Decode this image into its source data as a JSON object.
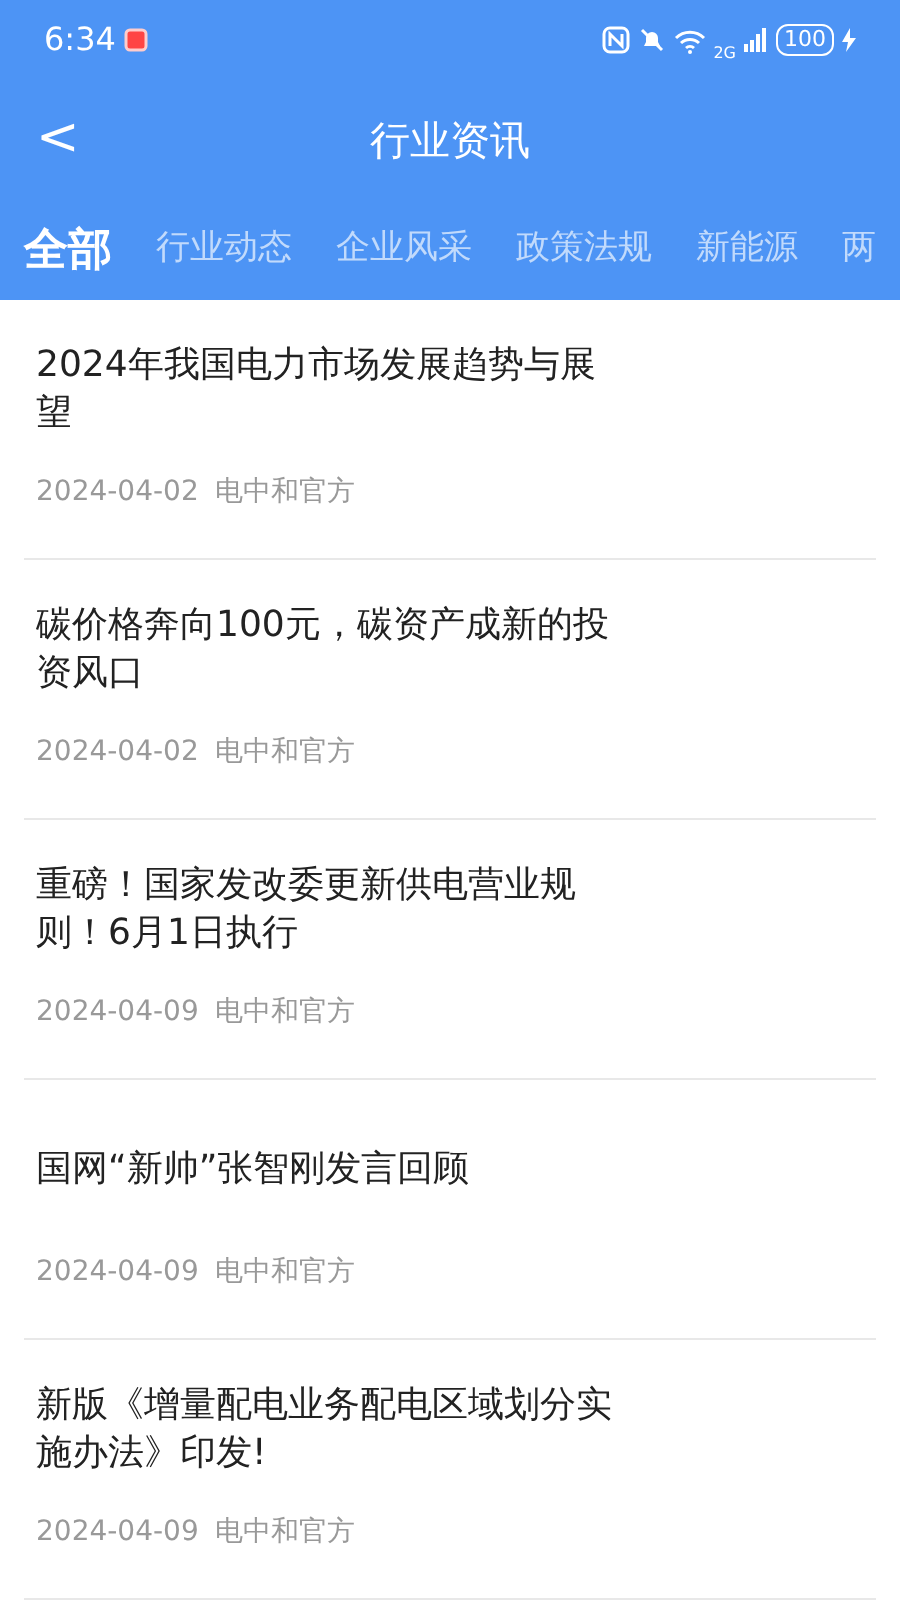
{
  "status_bar": {
    "time": "6:34",
    "network": "2G",
    "battery": "100"
  },
  "header": {
    "back": "<",
    "title": "行业资讯"
  },
  "tabs": [
    {
      "label": "全部",
      "selected": true
    },
    {
      "label": "行业动态",
      "selected": false
    },
    {
      "label": "企业风采",
      "selected": false
    },
    {
      "label": "政策法规",
      "selected": false
    },
    {
      "label": "新能源",
      "selected": false
    },
    {
      "label": "两",
      "selected": false
    }
  ],
  "articles": [
    {
      "title": "2024年我国电力市场发展趋势与展望",
      "date": "2024-04-02",
      "source": "电中和官方"
    },
    {
      "title": "碳价格奔向100元，碳资产成新的投资风口",
      "date": "2024-04-02",
      "source": "电中和官方"
    },
    {
      "title": "重磅！国家发改委更新供电营业规则！6月1日执行",
      "date": "2024-04-09",
      "source": "电中和官方"
    },
    {
      "title": "国网“新帅”张智刚发言回顾",
      "date": "2024-04-09",
      "source": "电中和官方"
    },
    {
      "title": "新版《增量配电业务配电区域划分实施办法》印发!",
      "date": "2024-04-09",
      "source": "电中和官方"
    }
  ]
}
